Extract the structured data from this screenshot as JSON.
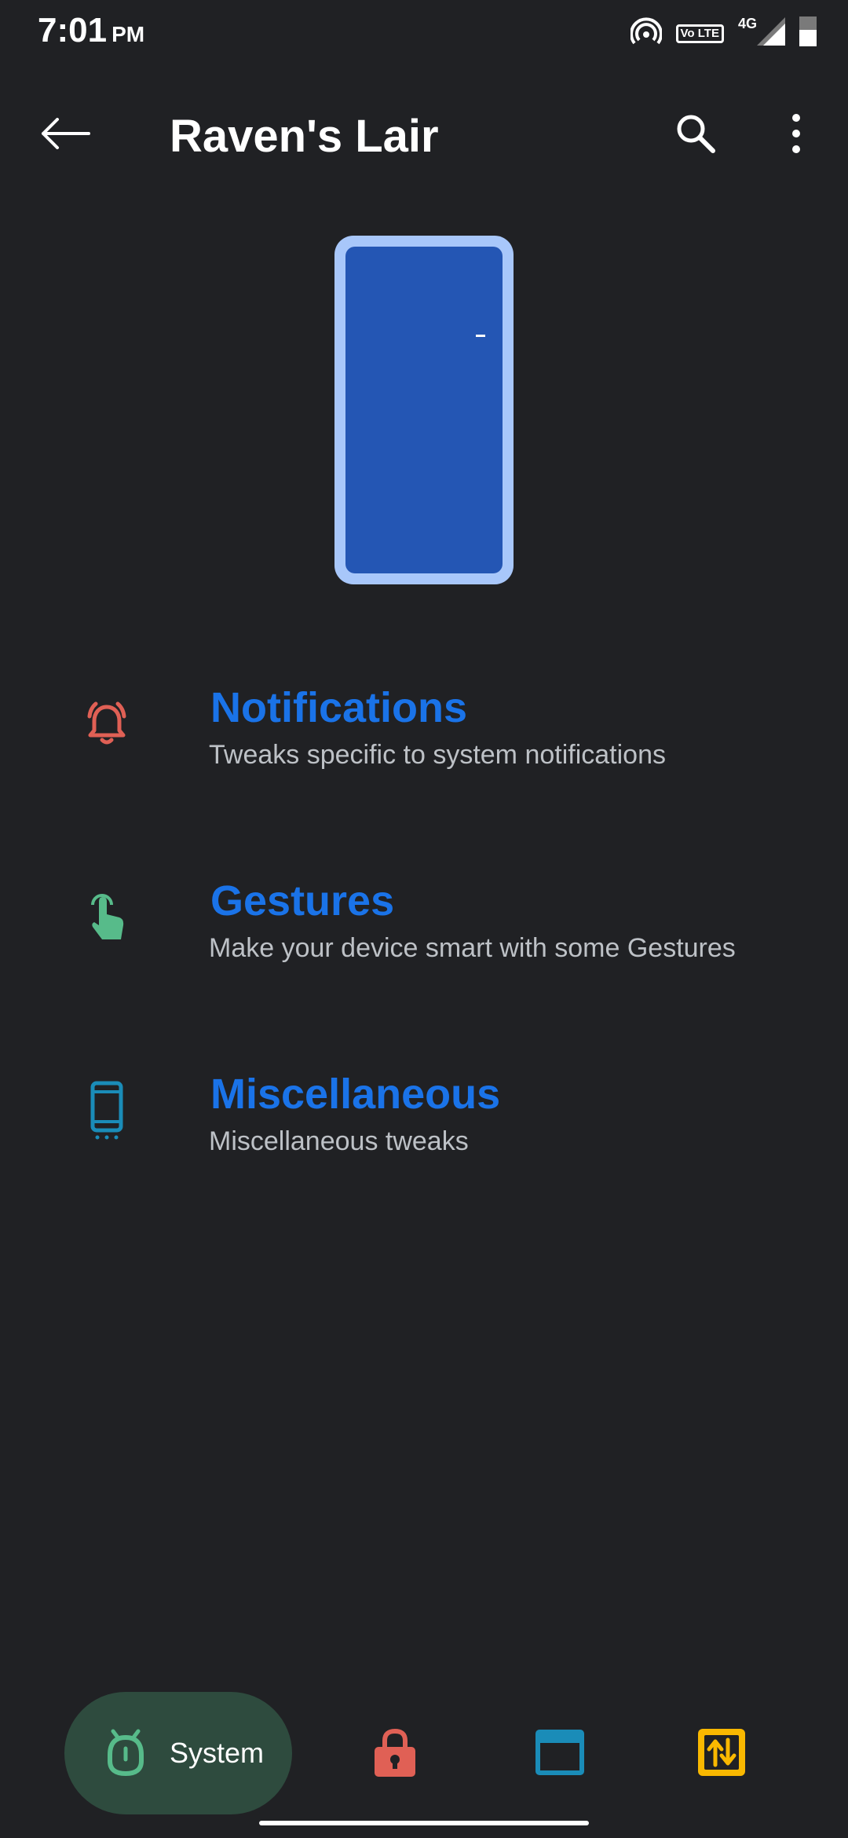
{
  "status_bar": {
    "time": "7:01",
    "ampm": "PM",
    "volte_label": "Vo LTE",
    "network_label": "4G",
    "icons": [
      "hotspot-icon",
      "volte-icon",
      "signal-icon",
      "battery-icon"
    ]
  },
  "app_bar": {
    "title": "Raven's Lair",
    "icons": [
      "back-arrow-icon",
      "search-icon",
      "more-vert-icon"
    ]
  },
  "illustration": {
    "frame_color": "#a8c7fa",
    "screen_color": "#2456b4"
  },
  "menu": {
    "items": [
      {
        "title": "Notifications",
        "subtitle": "Tweaks specific to system notifications",
        "icon": "bell-ringing-icon",
        "icon_color": "#e06055"
      },
      {
        "title": "Gestures",
        "subtitle": "Make your device smart with some Gestures",
        "icon": "touch-gesture-icon",
        "icon_color": "#57bb8a"
      },
      {
        "title": "Miscellaneous",
        "subtitle": "Miscellaneous tweaks",
        "icon": "phone-device-icon",
        "icon_color": "#1a8cb8"
      }
    ]
  },
  "bottom_nav": {
    "items": [
      {
        "label": "System",
        "icon": "android-head-icon",
        "icon_color": "#57bb8a",
        "selected": true
      },
      {
        "label": "",
        "icon": "lock-icon",
        "icon_color": "#e06055",
        "selected": false
      },
      {
        "label": "",
        "icon": "window-icon",
        "icon_color": "#1a8cb8",
        "selected": false
      },
      {
        "label": "",
        "icon": "swap-vertical-icon",
        "icon_color": "#f9b800",
        "selected": false
      }
    ]
  }
}
